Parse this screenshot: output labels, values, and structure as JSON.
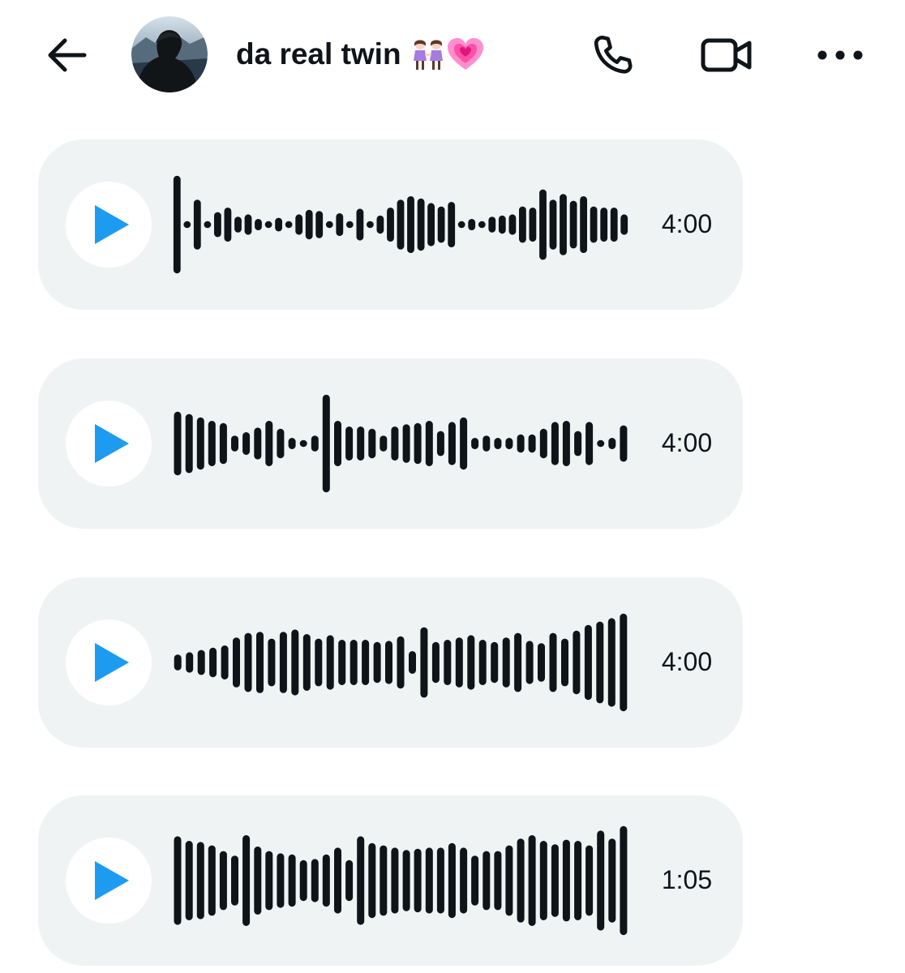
{
  "header": {
    "back_icon": "arrow-left-icon",
    "avatar_alt": "profile-photo",
    "title": "da real twin",
    "title_emojis": [
      "women-holding-hands-emoji",
      "growing-heart-emoji"
    ],
    "call_icon": "phone-icon",
    "video_icon": "video-camera-icon",
    "more_icon": "more-horizontal-icon"
  },
  "colors": {
    "accent": "#1d9bf0",
    "bubble": "#eff3f4",
    "text": "#0f1419",
    "wave": "#0f1419"
  },
  "voice_messages": [
    {
      "duration": "4:00",
      "levels": [
        0.86,
        0.06,
        0.44,
        0.06,
        0.22,
        0.3,
        0.14,
        0.18,
        0.1,
        0.06,
        0.12,
        0.06,
        0.18,
        0.26,
        0.24,
        0.06,
        0.2,
        0.06,
        0.28,
        0.06,
        0.16,
        0.3,
        0.44,
        0.5,
        0.46,
        0.38,
        0.32,
        0.4,
        0.06,
        0.1,
        0.06,
        0.14,
        0.16,
        0.18,
        0.32,
        0.3,
        0.62,
        0.44,
        0.54,
        0.42,
        0.5,
        0.32,
        0.3,
        0.3,
        0.18
      ]
    },
    {
      "duration": "4:00",
      "levels": [
        0.56,
        0.52,
        0.46,
        0.4,
        0.36,
        0.14,
        0.2,
        0.28,
        0.4,
        0.26,
        0.1,
        0.06,
        0.14,
        0.86,
        0.4,
        0.3,
        0.3,
        0.26,
        0.14,
        0.3,
        0.34,
        0.36,
        0.4,
        0.22,
        0.38,
        0.46,
        0.1,
        0.14,
        0.1,
        0.1,
        0.16,
        0.16,
        0.26,
        0.38,
        0.4,
        0.22,
        0.38,
        0.06,
        0.1,
        0.32
      ]
    },
    {
      "duration": "4:00",
      "levels": [
        0.14,
        0.18,
        0.22,
        0.26,
        0.3,
        0.44,
        0.52,
        0.54,
        0.42,
        0.54,
        0.58,
        0.5,
        0.42,
        0.48,
        0.4,
        0.4,
        0.4,
        0.36,
        0.38,
        0.46,
        0.2,
        0.62,
        0.36,
        0.4,
        0.44,
        0.48,
        0.4,
        0.36,
        0.44,
        0.52,
        0.38,
        0.34,
        0.52,
        0.42,
        0.56,
        0.66,
        0.72,
        0.78,
        0.86
      ]
    },
    {
      "duration": "1:05",
      "levels": [
        0.78,
        0.7,
        0.68,
        0.62,
        0.52,
        0.44,
        0.8,
        0.6,
        0.52,
        0.48,
        0.46,
        0.36,
        0.38,
        0.46,
        0.58,
        0.36,
        0.78,
        0.66,
        0.62,
        0.58,
        0.54,
        0.56,
        0.58,
        0.58,
        0.66,
        0.58,
        0.44,
        0.52,
        0.52,
        0.62,
        0.74,
        0.8,
        0.7,
        0.64,
        0.72,
        0.7,
        0.62,
        0.88,
        0.74,
        0.96
      ]
    }
  ]
}
